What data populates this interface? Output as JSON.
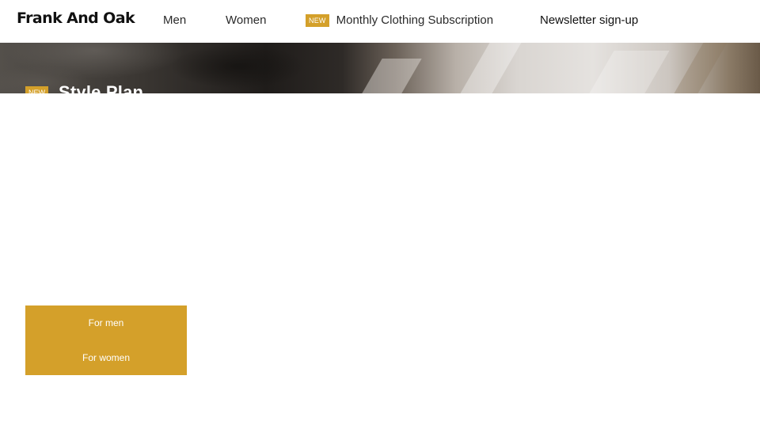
{
  "header": {
    "logo": "Frank And Oak",
    "nav": {
      "men": "Men",
      "women": "Women",
      "subscription_badge": "NEW",
      "subscription": "Monthly Clothing Subscription",
      "newsletter": "Newsletter sign-up"
    }
  },
  "hero": {
    "badge": "NEW",
    "title": "Style Plan"
  },
  "cta": {
    "for_men": "For men",
    "for_women": "For women"
  },
  "colors": {
    "accent": "#d4a02a",
    "text": "#1a1a1a",
    "background": "#ffffff"
  }
}
